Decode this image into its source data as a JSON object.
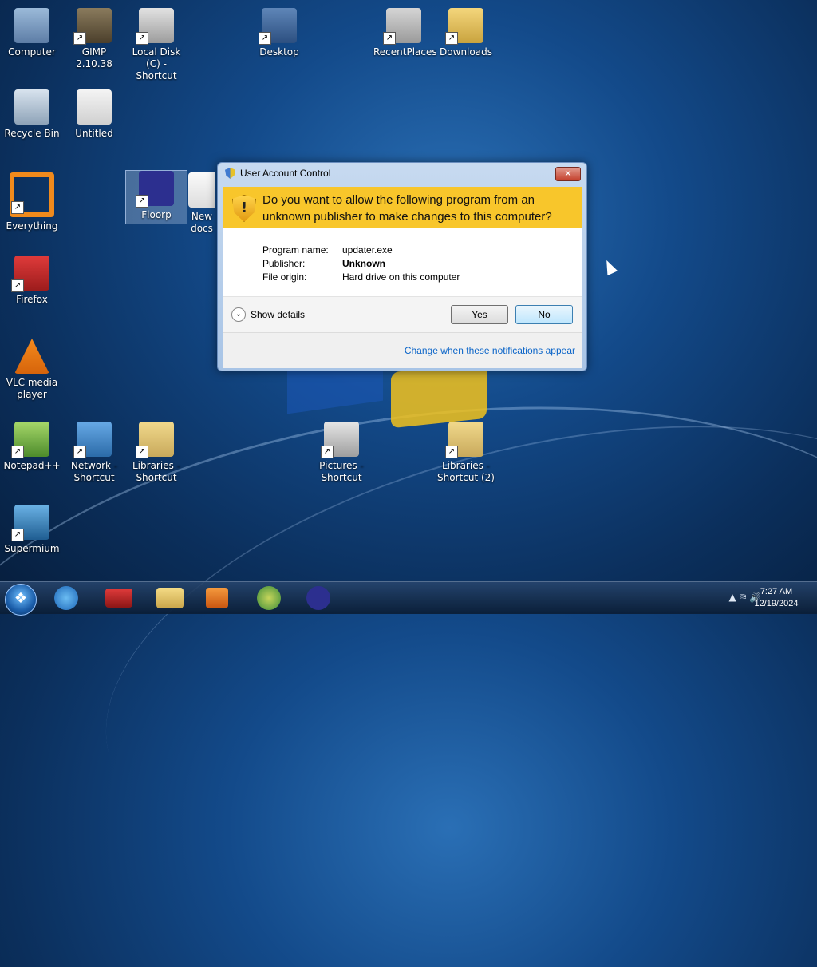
{
  "desktop": {
    "icons": [
      {
        "id": "computer",
        "label": "Computer"
      },
      {
        "id": "gimp",
        "label": "GIMP 2.10.38"
      },
      {
        "id": "local-disk",
        "label": "Local Disk (C) - Shortcut"
      },
      {
        "id": "desktop",
        "label": "Desktop"
      },
      {
        "id": "recentplaces",
        "label": "RecentPlaces"
      },
      {
        "id": "downloads",
        "label": "Downloads"
      },
      {
        "id": "recycle-bin",
        "label": "Recycle Bin"
      },
      {
        "id": "untitled",
        "label": "Untitled"
      },
      {
        "id": "everything",
        "label": "Everything"
      },
      {
        "id": "floorp",
        "label": "Floorp"
      },
      {
        "id": "new-doc",
        "label": "New docs"
      },
      {
        "id": "firefox",
        "label": "Firefox"
      },
      {
        "id": "vlc",
        "label": "VLC media player"
      },
      {
        "id": "notepadpp",
        "label": "Notepad++"
      },
      {
        "id": "network",
        "label": "Network - Shortcut"
      },
      {
        "id": "libraries",
        "label": "Libraries - Shortcut"
      },
      {
        "id": "pictures",
        "label": "Pictures - Shortcut"
      },
      {
        "id": "libraries2",
        "label": "Libraries - Shortcut (2)"
      },
      {
        "id": "supermium",
        "label": "Supermium"
      }
    ]
  },
  "uac": {
    "title": "User Account Control",
    "close_label": "✕",
    "question": "Do you want to allow the following program from an unknown publisher to make changes to this computer?",
    "shield_mark": "!",
    "details": {
      "program_name_label": "Program name:",
      "program_name_value": "updater.exe",
      "publisher_label": "Publisher:",
      "publisher_value": "Unknown",
      "file_origin_label": "File origin:",
      "file_origin_value": "Hard drive on this computer"
    },
    "show_details_label": "Show details",
    "yes_label": "Yes",
    "no_label": "No",
    "change_link": "Change when these notifications appear"
  },
  "taskbar": {
    "start_glyph": "❖",
    "tray_icons": "▲  ⛿  🔊",
    "time": "7:27 AM",
    "date": "12/19/2024"
  }
}
